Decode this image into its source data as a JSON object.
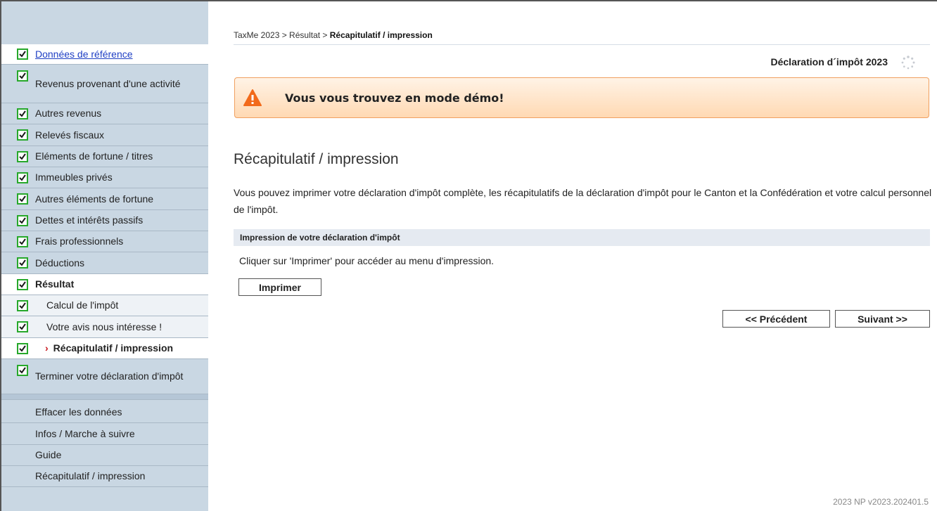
{
  "breadcrumb": {
    "path": "TaxMe 2023 > Résultat > ",
    "current": "Récapitulatif / impression"
  },
  "header": {
    "declaration_title": "Déclaration d´impôt 2023"
  },
  "demo_banner": {
    "text": "Vous vous trouvez en mode démo!",
    "color": "#f0a060"
  },
  "page": {
    "heading": "Récapitulatif / impression",
    "intro": "Vous pouvez imprimer votre déclaration d'impôt complète, les récapitulatifs de la déclaration d'impôt pour le Canton et la Confédération et votre calcul personnel de l'impôt.",
    "section_title": "Impression de votre déclaration d'impôt",
    "section_text": "Cliquer sur 'Imprimer' pour accéder au menu d'impression.",
    "print_button": "Imprimer",
    "prev_button": "<< Précédent",
    "next_button": "Suivant >>"
  },
  "sidebar": {
    "items": [
      {
        "label": "Données de référence",
        "checked": true
      },
      {
        "label": "Revenus provenant d'une activité",
        "checked": true
      },
      {
        "label": "Autres revenus",
        "checked": true
      },
      {
        "label": "Relevés fiscaux",
        "checked": true
      },
      {
        "label": "Eléments de fortune / titres",
        "checked": true
      },
      {
        "label": "Immeubles privés",
        "checked": true
      },
      {
        "label": "Autres éléments de fortune",
        "checked": true
      },
      {
        "label": "Dettes et intérêts passifs",
        "checked": true
      },
      {
        "label": "Frais professionnels",
        "checked": true
      },
      {
        "label": "Déductions",
        "checked": true
      },
      {
        "label": "Résultat",
        "checked": true
      },
      {
        "label": "Calcul de l'impôt",
        "checked": true
      },
      {
        "label": "Votre avis nous intéresse !",
        "checked": true
      },
      {
        "label": "Récapitulatif / impression",
        "checked": true,
        "active": true
      },
      {
        "label": "Terminer votre déclaration d'impôt",
        "checked": true
      }
    ],
    "extras": [
      {
        "label": "Effacer les données"
      },
      {
        "label": "Infos / Marche à suivre"
      },
      {
        "label": "Guide"
      },
      {
        "label": "Récapitulatif / impression"
      }
    ],
    "check_color": "#27a82b"
  },
  "footer": {
    "version": "2023 NP v2023.202401.5"
  }
}
